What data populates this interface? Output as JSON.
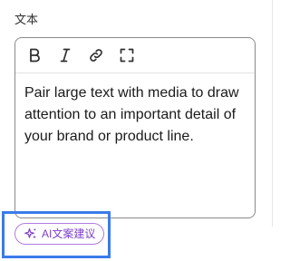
{
  "field": {
    "label": "文本"
  },
  "toolbar": {
    "buttons": [
      {
        "name": "bold",
        "icon": "bold-icon"
      },
      {
        "name": "italic",
        "icon": "italic-icon"
      },
      {
        "name": "link",
        "icon": "link-icon"
      },
      {
        "name": "expand",
        "icon": "expand-icon"
      }
    ]
  },
  "editor": {
    "content": "Pair large text with media to draw attention to an important detail of your brand or product line."
  },
  "ai_suggest": {
    "label": "AI文案建议",
    "icon": "sparkle-icon"
  },
  "colors": {
    "accent_purple": "#7d3fc8",
    "highlight_blue": "#3a7bea",
    "editor_border": "#8a8a8a"
  }
}
